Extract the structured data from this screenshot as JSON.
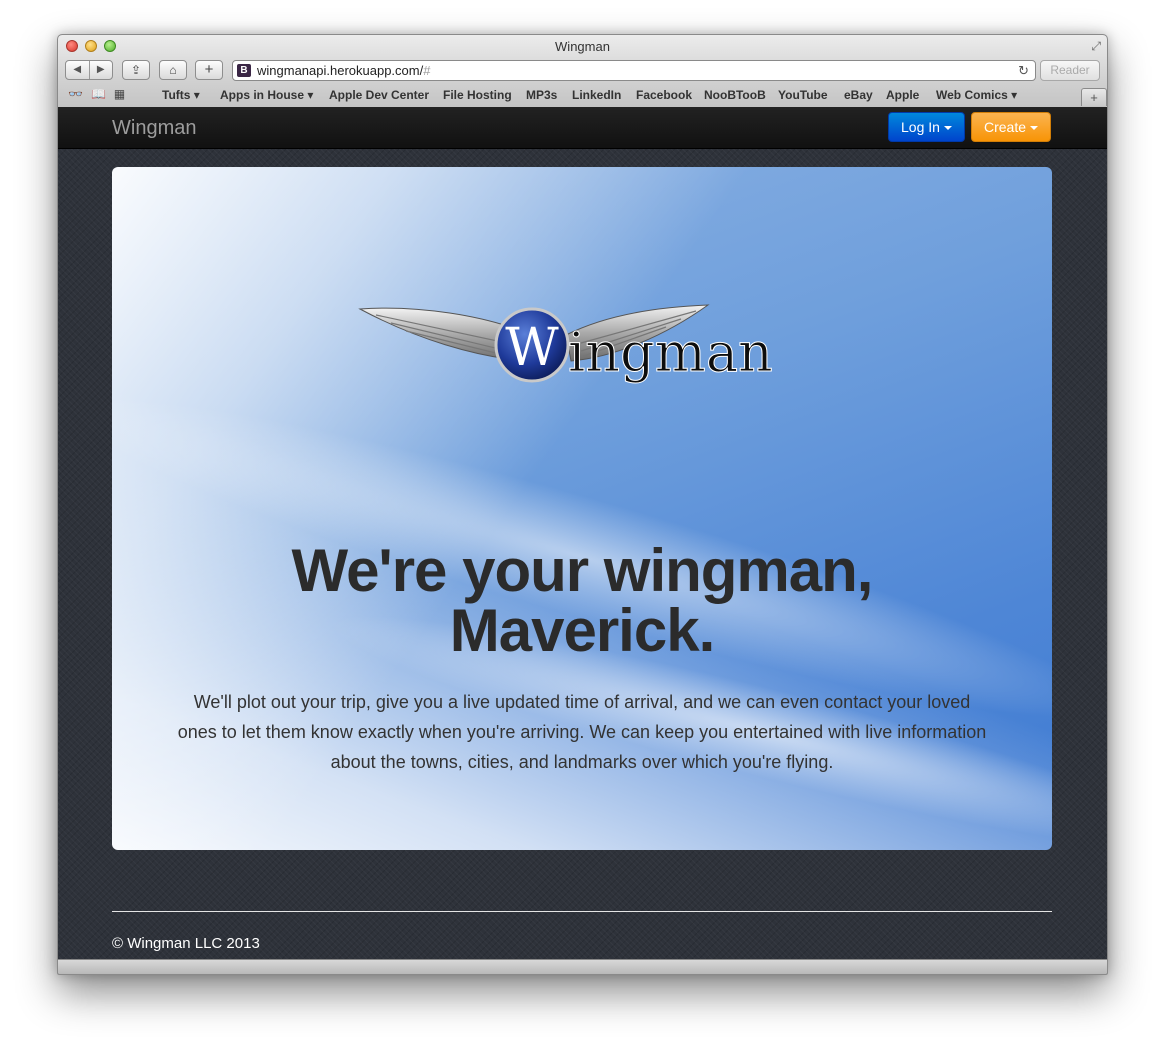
{
  "window": {
    "title": "Wingman"
  },
  "toolbar": {
    "back_glyph": "◀",
    "forward_glyph": "▶",
    "favicon_letter": "B",
    "url_main": "wingmanapi.herokuapp.com/",
    "url_hash": "#",
    "reload_glyph": "↻",
    "reader_label": "Reader"
  },
  "bookmarks": [
    "Tufts ▾",
    "Apps in House ▾",
    "Apple Dev Center",
    "File Hosting",
    "MP3s",
    "LinkedIn",
    "Facebook",
    "NooBTooB",
    "YouTube",
    "eBay",
    "Apple",
    "Web Comics ▾"
  ],
  "navbar": {
    "brand": "Wingman",
    "login_label": "Log In",
    "create_label": "Create"
  },
  "hero": {
    "logo_letter": "W",
    "logo_text": "ingman",
    "headline_line1": "We're your wingman,",
    "headline_line2": "Maverick.",
    "lead": "We'll plot out your trip, give you a live updated time of arrival, and we can even contact your loved ones to let them know exactly when you're arriving. We can keep you entertained with live information about the towns, cities, and landmarks over which you're flying."
  },
  "footer": {
    "copyright": "© Wingman LLC 2013"
  },
  "colors": {
    "login_button": "#0055cc",
    "create_button": "#f89406",
    "navbar": "#1b1b1b"
  }
}
